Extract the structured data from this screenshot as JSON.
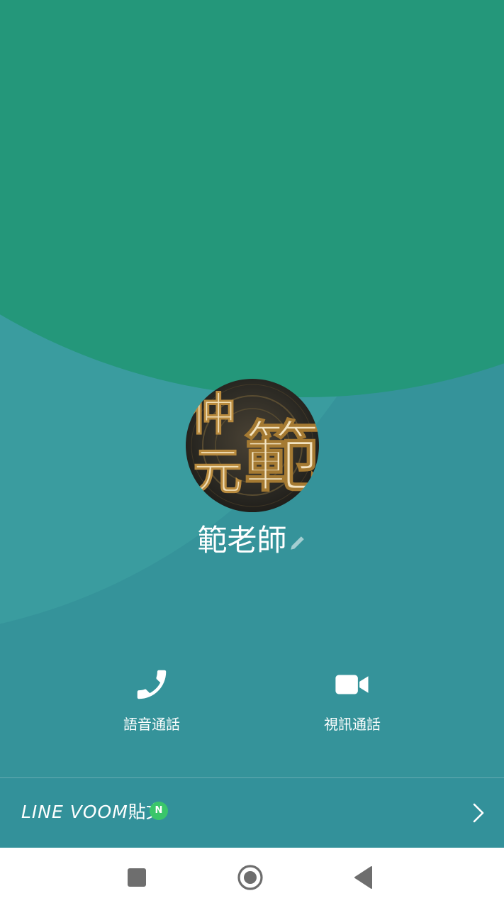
{
  "profile": {
    "name": "範老師",
    "avatar_text_top": "仲",
    "avatar_text_bottom": "元",
    "avatar_text_large": "範"
  },
  "actions": {
    "voice_call_label": "語音通話",
    "video_call_label": "視訊通話"
  },
  "voom": {
    "label_latin": "LINE VOOM",
    "label_cjk": "貼文",
    "badge": "N"
  },
  "colors": {
    "background_teal": "#35939a",
    "background_green": "#24977a",
    "badge_green": "#3ac66a",
    "navbar": "#ffffff"
  },
  "icons": {
    "edit": "pencil-icon",
    "voice_call": "phone-icon",
    "video_call": "video-camera-icon",
    "voom_arrow": "chevron-right-icon",
    "nav_recents": "square-icon",
    "nav_home": "circle-icon",
    "nav_back": "triangle-back-icon"
  }
}
